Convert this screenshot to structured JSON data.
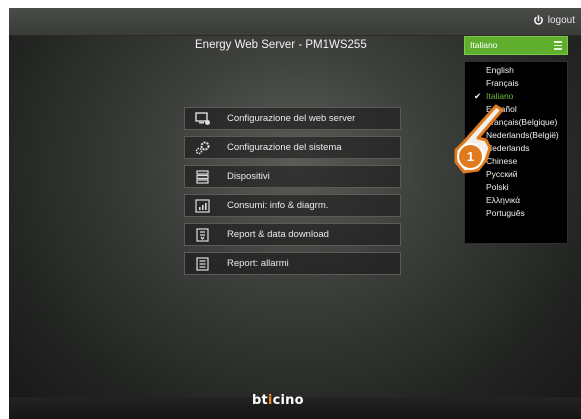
{
  "topbar": {
    "logout_label": "logout"
  },
  "header": {
    "title": "Energy Web Server - PM1WS255"
  },
  "language": {
    "selected": "Italiano",
    "options": [
      "English",
      "Français",
      "Italiano",
      "Español",
      "Français(Belgique)",
      "Nederlands(België)",
      "Nederlands",
      "Chinese",
      "Русский",
      "Polski",
      "Ελληνικά",
      "Português"
    ],
    "checked_index": 2
  },
  "menu": {
    "items": [
      {
        "label": "Configurazione del web server",
        "icon": "web-server-config-icon"
      },
      {
        "label": "Configurazione del sistema",
        "icon": "system-config-icon"
      },
      {
        "label": "Dispositivi",
        "icon": "devices-icon"
      },
      {
        "label": "Consumi: info & diagrm.",
        "icon": "consumption-chart-icon"
      },
      {
        "label": "Report & data download",
        "icon": "report-download-icon"
      },
      {
        "label": "Report: allarmi",
        "icon": "alarm-report-icon"
      }
    ]
  },
  "annotation": {
    "step": "1"
  },
  "footer": {
    "brand_prefix": "bt",
    "brand_accent": "i",
    "brand_suffix": "cino"
  },
  "colors": {
    "accent": "#5fae2e",
    "brand_orange": "#f08a1c",
    "badge": "#e07a1f"
  }
}
